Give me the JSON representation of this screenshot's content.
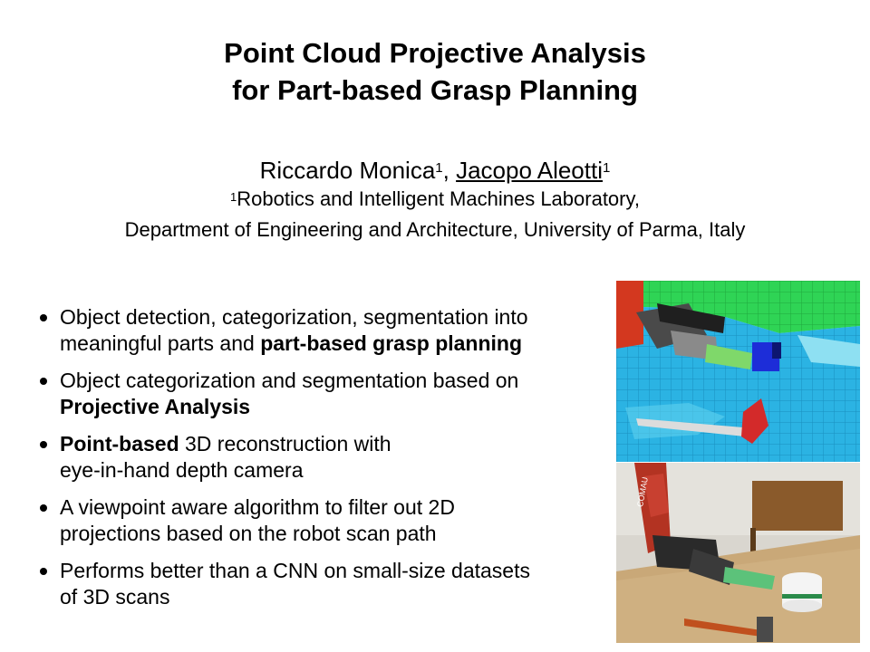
{
  "title": {
    "line1": "Point Cloud Projective Analysis",
    "line2": "for Part-based Grasp Planning"
  },
  "authors": {
    "author1": "Riccardo Monica",
    "author1_sup": "1",
    "separator": ", ",
    "author2": "Jacopo Aleotti",
    "author2_sup": "1"
  },
  "affiliation": {
    "sup": "1",
    "line1": "Robotics and Intelligent Machines Laboratory,",
    "line2": "Department of Engineering and Architecture, University of Parma, Italy"
  },
  "bullets": [
    {
      "l1": "Object detection, categorization, segmentation into",
      "l2a": "meaningful parts and ",
      "l2b": "part-based grasp planning"
    },
    {
      "l1": "Object categorization and segmentation based on",
      "l2b": "Projective Analysis"
    },
    {
      "l1b": "Point-based",
      "l1a": " 3D reconstruction with",
      "l2": "eye-in-hand depth camera"
    },
    {
      "l1": "A viewpoint aware algorithm to filter out 2D",
      "l2": "projections based on the robot scan path"
    },
    {
      "l1": "Performs better than a CNN on small-size datasets",
      "l2": "of 3D scans"
    }
  ],
  "images": {
    "top": "3D reconstruction of robot gripper grasping a mug with voxel scene",
    "bottom": "Photo of robot arm with gripper grasping a mug on a wooden table",
    "robot_brand": "COMAU"
  }
}
